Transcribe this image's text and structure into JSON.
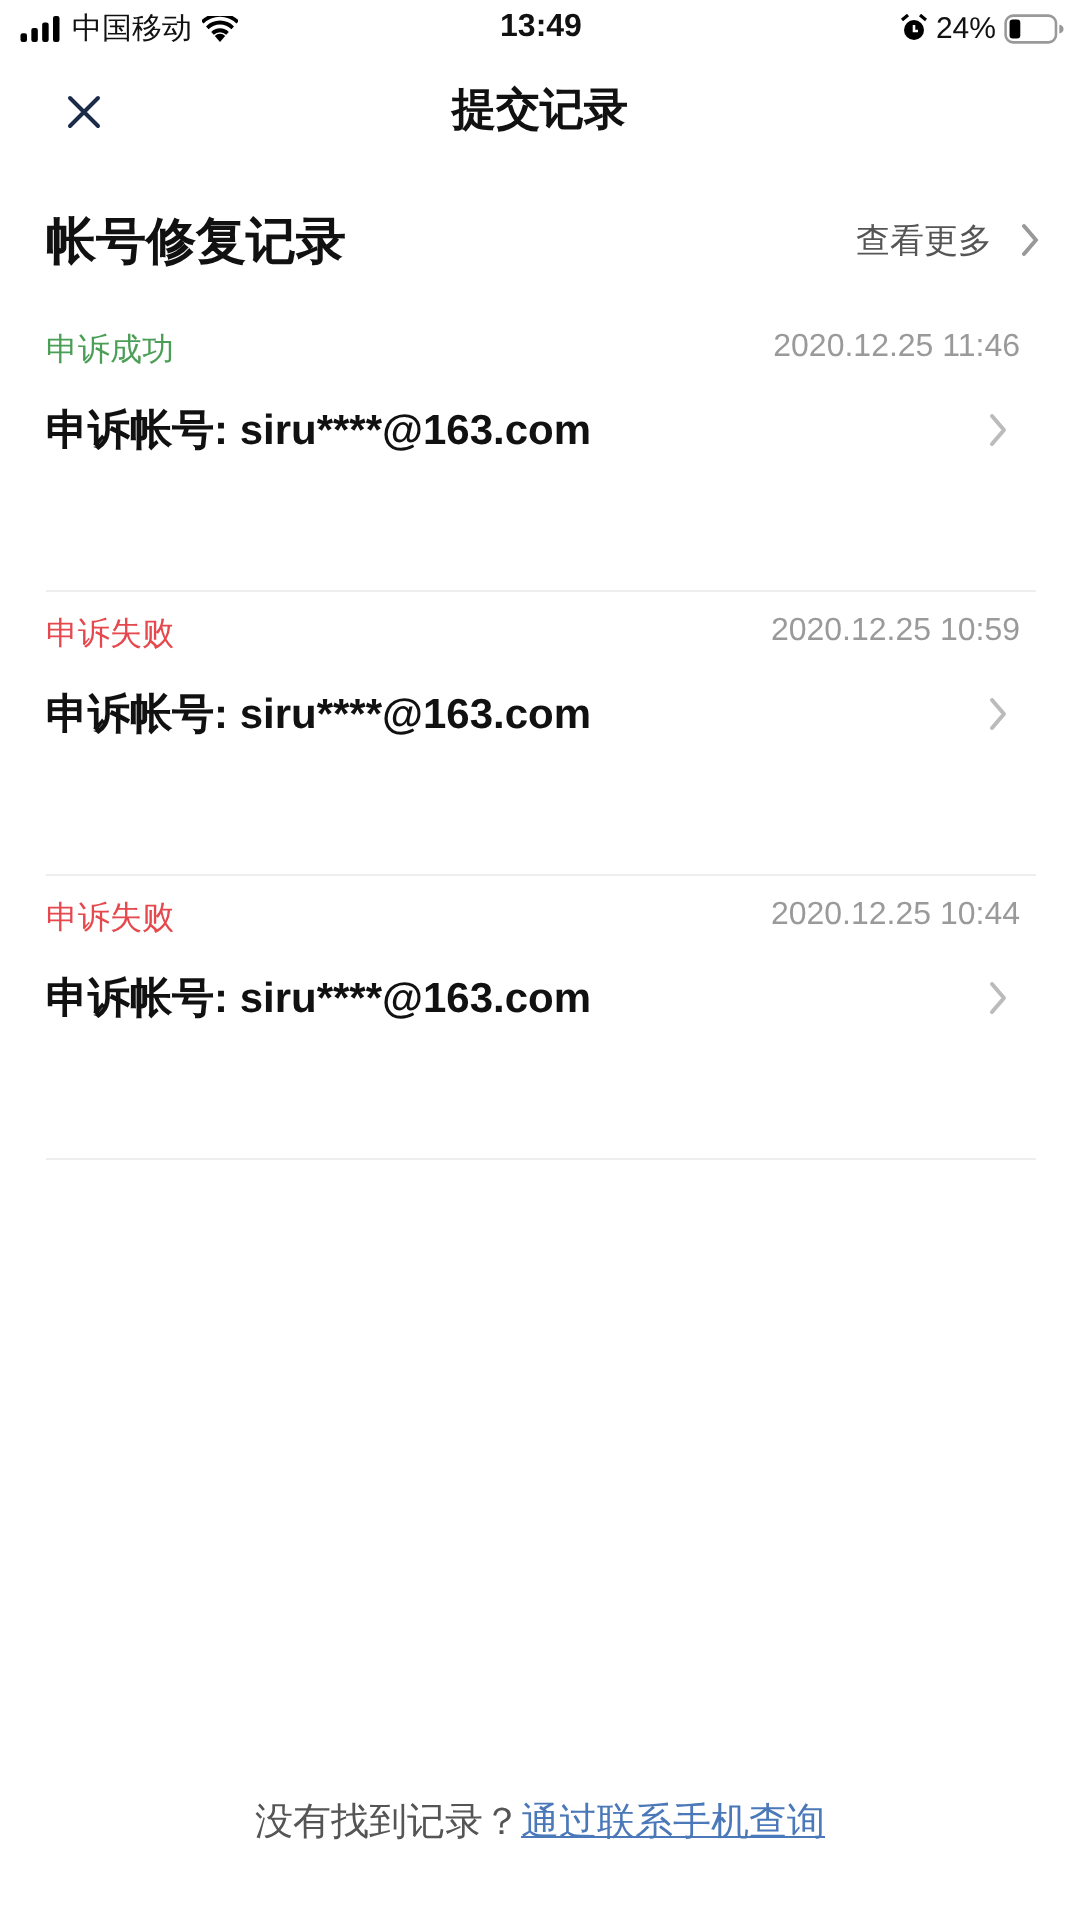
{
  "status_bar": {
    "carrier": "中国移动",
    "time": "13:49",
    "battery": "24%"
  },
  "nav": {
    "title": "提交记录"
  },
  "section": {
    "title": "帐号修复记录",
    "more": "查看更多"
  },
  "records": [
    {
      "status": "申诉成功",
      "kind": "success",
      "time": "2020.12.25 11:46",
      "account": "申诉帐号: siru****@163.com"
    },
    {
      "status": "申诉失败",
      "kind": "failed",
      "time": "2020.12.25 10:59",
      "account": "申诉帐号: siru****@163.com"
    },
    {
      "status": "申诉失败",
      "kind": "failed",
      "time": "2020.12.25 10:44",
      "account": "申诉帐号: siru****@163.com"
    }
  ],
  "footer": {
    "text": "没有找到记录？",
    "link": "通过联系手机查询"
  }
}
